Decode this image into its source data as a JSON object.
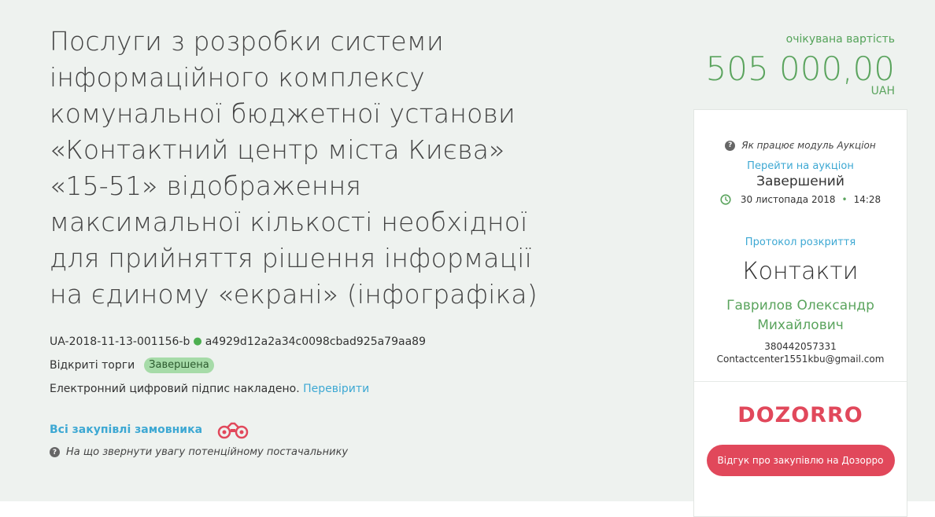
{
  "tender": {
    "title": "Послуги з розробки системи інформаційного комплексу комунальної бюджетної установи «Контактний центр міста Києва» «15-51» відображення максимальної кількості необхідної для прийняття рішення інформації на єдиному «екрані» (інфографіка)",
    "id": "UA-2018-11-13-001156-b",
    "hash": "a4929d12a2a34c0098cbad925a79aa89",
    "procedure": "Відкриті торги",
    "status_badge": "Завершена",
    "signature_text": "Електронний цифровий підпис накладено.",
    "verify_link": "Перевірити",
    "all_purchases_link": "Всі закупівлі замовника",
    "supplier_hint": "На що звернути увагу потенційному постачальнику"
  },
  "price": {
    "caption": "очікувана вартість",
    "value": "505 000,00",
    "currency": "UAH"
  },
  "auction": {
    "help": "Як працює модуль Аукціон",
    "goto_link": "Перейти на аукціон",
    "status": "Завершений",
    "date": "30 листопада 2018",
    "separator": "•",
    "time": "14:28",
    "protocol_link": "Протокол розкриття"
  },
  "contacts": {
    "title": "Контакти",
    "name_line1": "Гаврилов Олександр",
    "name_line2": "Михайлович",
    "phone": "380442057331",
    "email": "Contactcenter1551kbu@gmail.com"
  },
  "dozorro": {
    "logo_text": "DOZORRO",
    "button": "Відгук про закупівлю на Дозорро"
  },
  "colors": {
    "green": "#5ba45e",
    "link": "#3da8d3",
    "dozorro": "#e1485b",
    "badge_bg": "#a6dba8"
  },
  "icons": {
    "help": "question-circle-icon",
    "clock": "clock-icon",
    "binoculars": "binoculars-icon"
  }
}
